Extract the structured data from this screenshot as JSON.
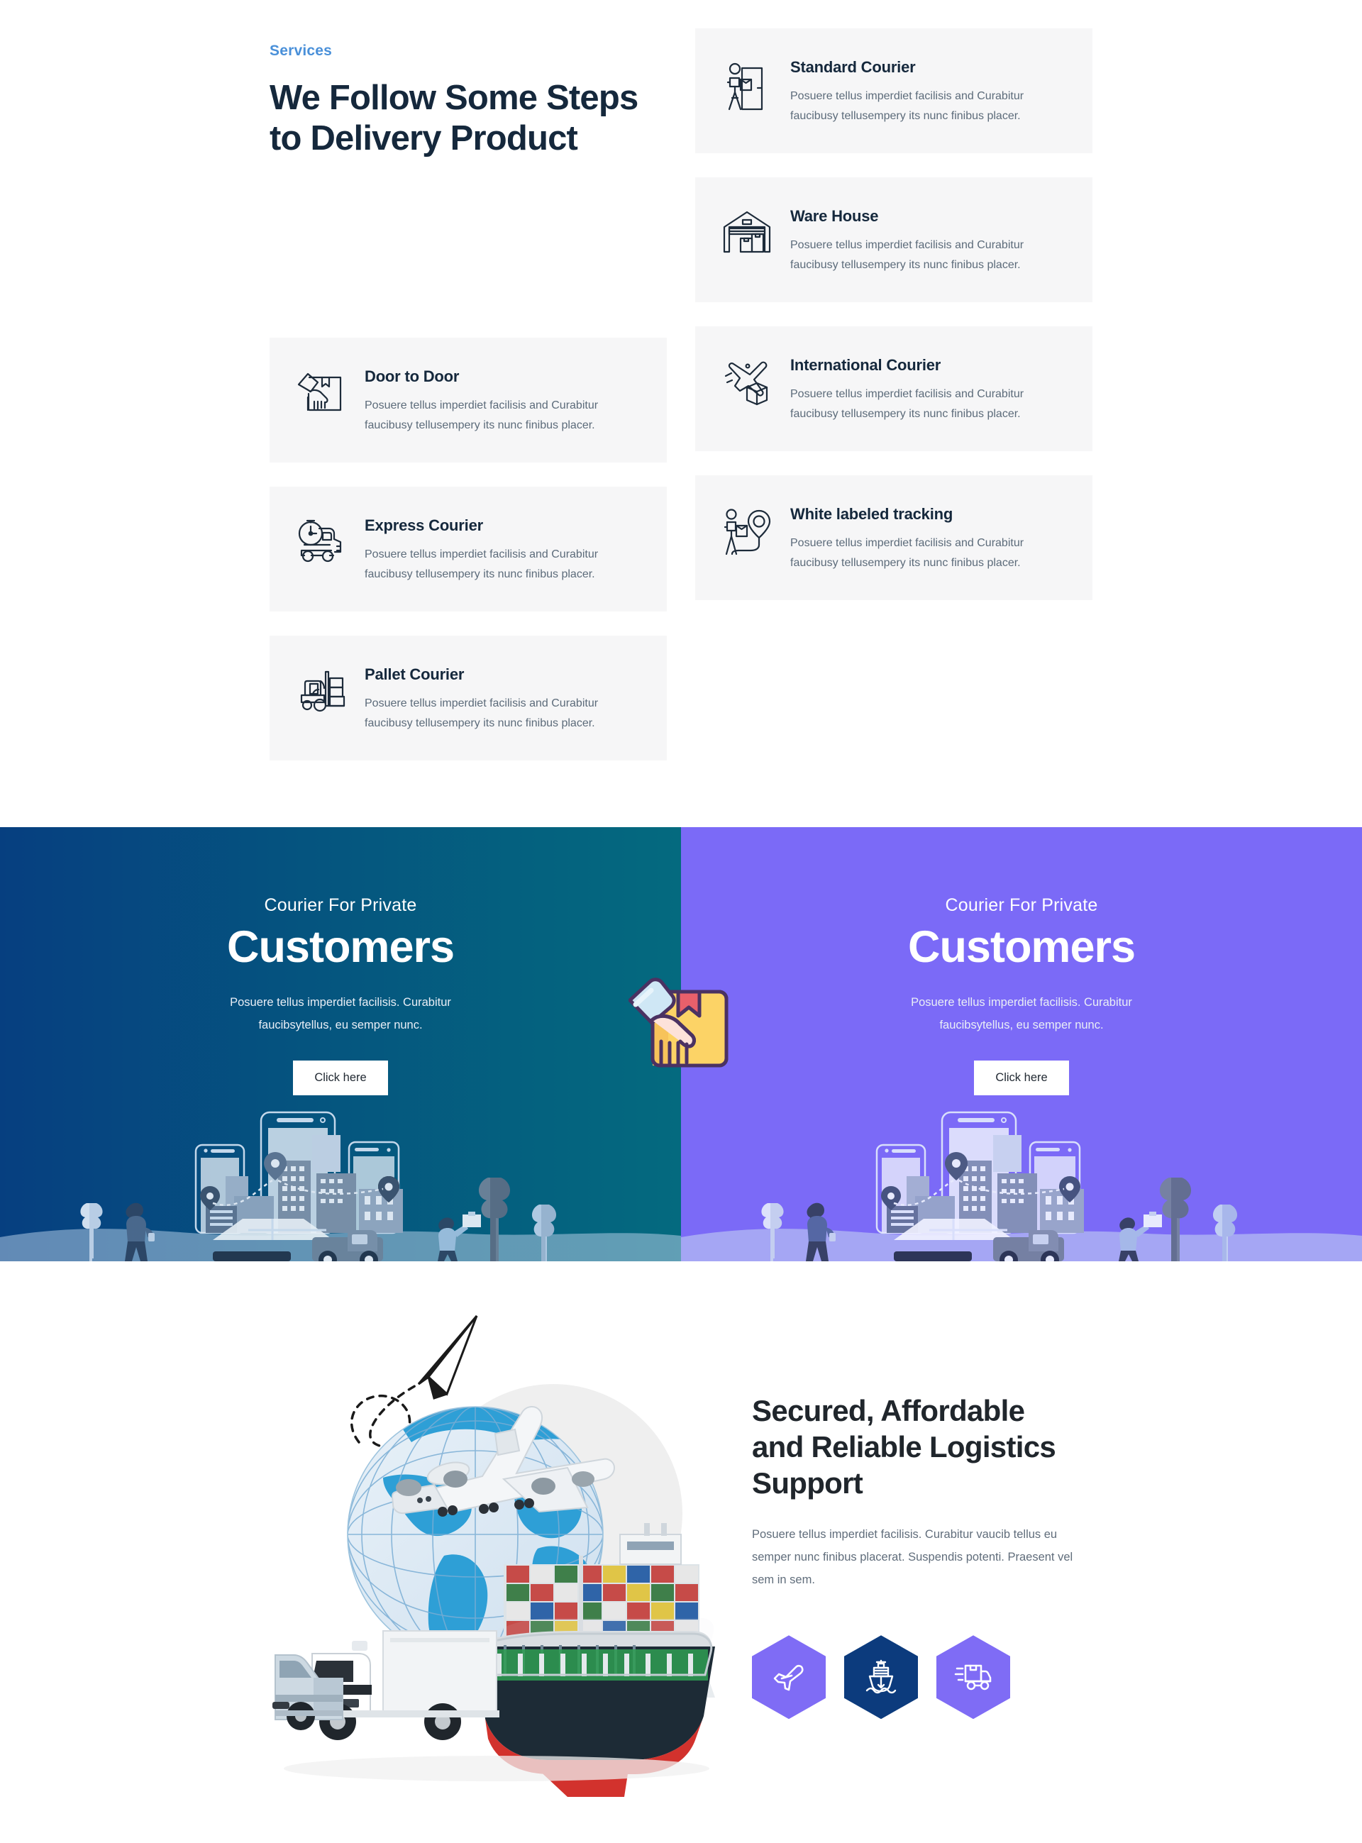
{
  "services": {
    "eyebrow": "Services",
    "title": "We Follow Some Steps to Delivery Product",
    "cards": [
      {
        "icon": "courier-person-door-icon",
        "title": "Standard Courier",
        "desc": "Posuere tellus imperdiet facilisis and Curabitur faucibusy tellusempery its nunc finibus placer."
      },
      {
        "icon": "hand-package-icon",
        "title": "Door to Door",
        "desc": "Posuere tellus imperdiet facilisis and Curabitur faucibusy tellusempery its nunc finibus placer."
      },
      {
        "icon": "warehouse-icon",
        "title": "Ware House",
        "desc": "Posuere tellus imperdiet facilisis and Curabitur faucibusy tellusempery its nunc finibus placer."
      },
      {
        "icon": "stopwatch-truck-icon",
        "title": "Express Courier",
        "desc": "Posuere tellus imperdiet facilisis and Curabitur faucibusy tellusempery its nunc finibus placer."
      },
      {
        "icon": "airplane-box-icon",
        "title": "International Courier",
        "desc": "Posuere tellus imperdiet facilisis and Curabitur faucibusy tellusempery its nunc finibus placer."
      },
      {
        "icon": "forklift-pallet-icon",
        "title": "Pallet Courier",
        "desc": "Posuere tellus imperdiet facilisis and Curabitur faucibusy tellusempery its nunc finibus placer."
      },
      {
        "icon": "person-package-map-pin-icon",
        "title": "White labeled tracking",
        "desc": "Posuere tellus imperdiet facilisis and Curabitur faucibusy tellusempery its nunc finibus placer."
      }
    ]
  },
  "promo": {
    "left": {
      "kicker": "Courier For Private",
      "title": "Customers",
      "desc": "Posuere tellus imperdiet facilisis. Curabitur faucibsytellus, eu semper nunc.",
      "button": "Click here",
      "bg_start": "#063f80",
      "bg_end": "#046a7f"
    },
    "right": {
      "kicker": "Courier For Private",
      "title": "Customers",
      "desc": "Posuere tellus imperdiet facilisis. Curabitur faucibsytellus, eu semper nunc.",
      "button": "Click here",
      "bg": "#7b6af7"
    }
  },
  "logistics": {
    "title": "Secured, Affordable and Reliable Logistics Support",
    "desc": "Posuere tellus imperdiet facilisis. Curabitur vaucib tellus eu semper nunc finibus placerat. Suspendis potenti. Praesent vel sem in sem.",
    "badges": [
      {
        "icon": "airplane-icon",
        "color": "#7f6cf5"
      },
      {
        "icon": "cargo-ship-icon",
        "color": "#0c3b7d"
      },
      {
        "icon": "delivery-truck-icon",
        "color": "#7f6cf5"
      }
    ]
  },
  "colors": {
    "accent_blue": "#4a90d9",
    "heading": "#15283c",
    "body_text": "#5c6b7a",
    "card_bg": "#f6f6f7",
    "purple": "#7b6af7",
    "navy": "#063f80",
    "teal": "#046a7f"
  }
}
